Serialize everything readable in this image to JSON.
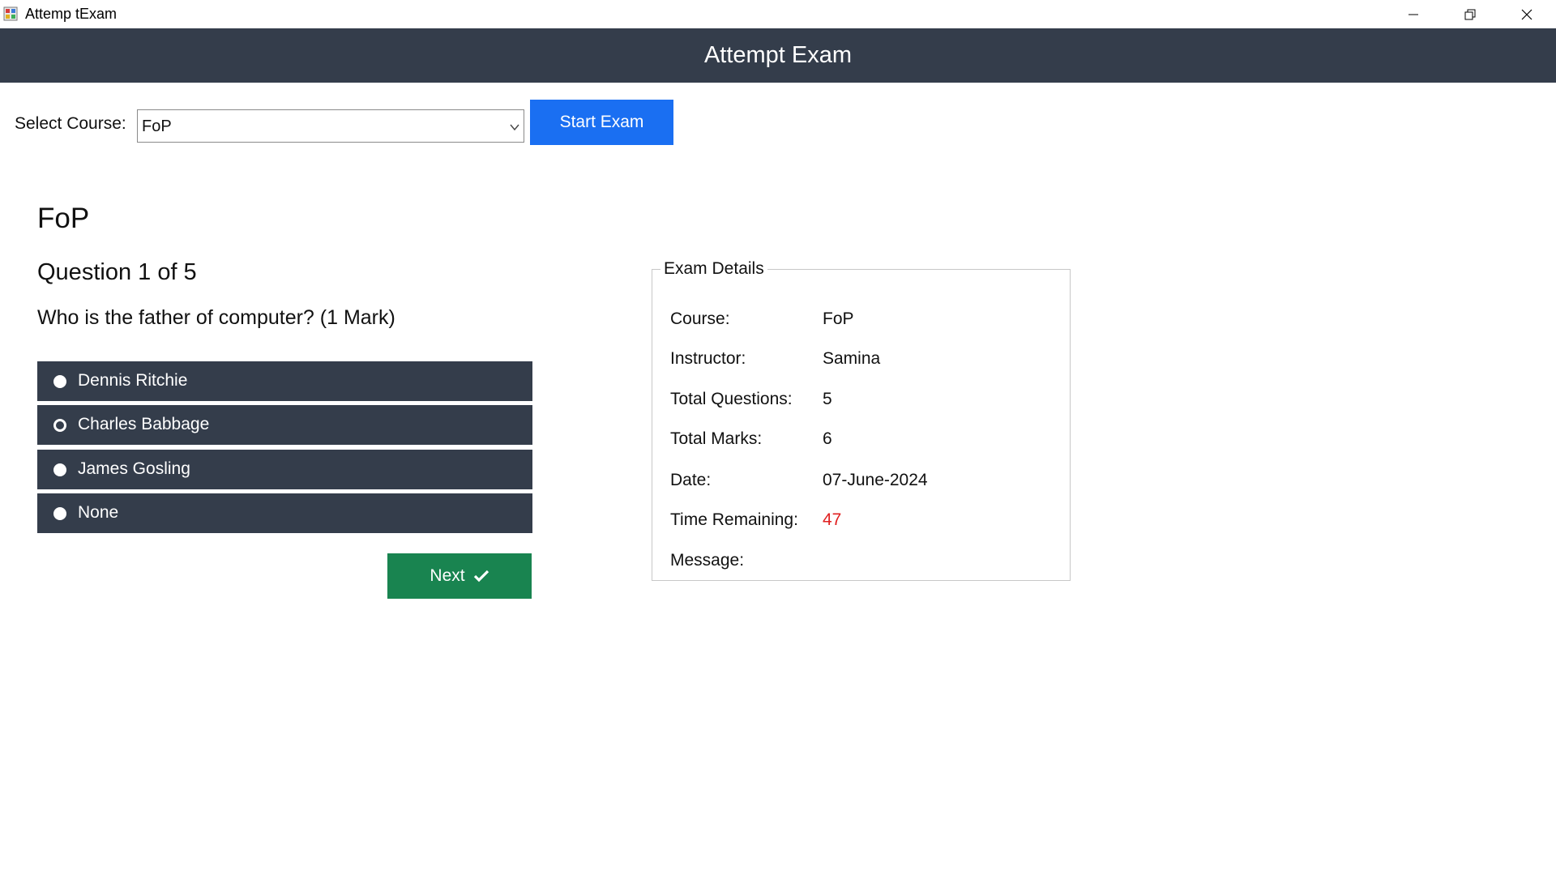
{
  "window": {
    "title": "Attemp tExam"
  },
  "header": {
    "title": "Attempt Exam"
  },
  "course_select": {
    "label": "Select Course:",
    "value": "FoP",
    "start_label": "Start Exam"
  },
  "question": {
    "course": "FoP",
    "number_text": "Question 1 of 5",
    "text": "Who is the father of computer? (1 Mark)",
    "options": [
      {
        "label": "Dennis Ritchie",
        "selected": false
      },
      {
        "label": "Charles Babbage",
        "selected": true
      },
      {
        "label": "James Gosling",
        "selected": false
      },
      {
        "label": "None",
        "selected": false
      }
    ],
    "next_label": "Next"
  },
  "exam_details": {
    "title": "Exam Details",
    "course_label": "Course:",
    "course_value": "FoP",
    "instructor_label": "Instructor:",
    "instructor_value": "Samina",
    "total_questions_label": "Total Questions:",
    "total_questions_value": "5",
    "total_marks_label": "Total Marks:",
    "total_marks_value": "6",
    "date_label": "Date:",
    "date_value": "07-June-2024",
    "time_remaining_label": "Time Remaining:",
    "time_remaining_value": "47",
    "message_label": "Message:",
    "message_value": ""
  },
  "colors": {
    "header_bg": "#343d4b",
    "start_button": "#1a6ff2",
    "next_button": "#198450",
    "time_remaining": "#e02020"
  },
  "icons": [
    "app-icon",
    "minimize-icon",
    "restore-icon",
    "close-icon",
    "chevron-down-icon",
    "radio-icon",
    "checkmark-icon"
  ]
}
